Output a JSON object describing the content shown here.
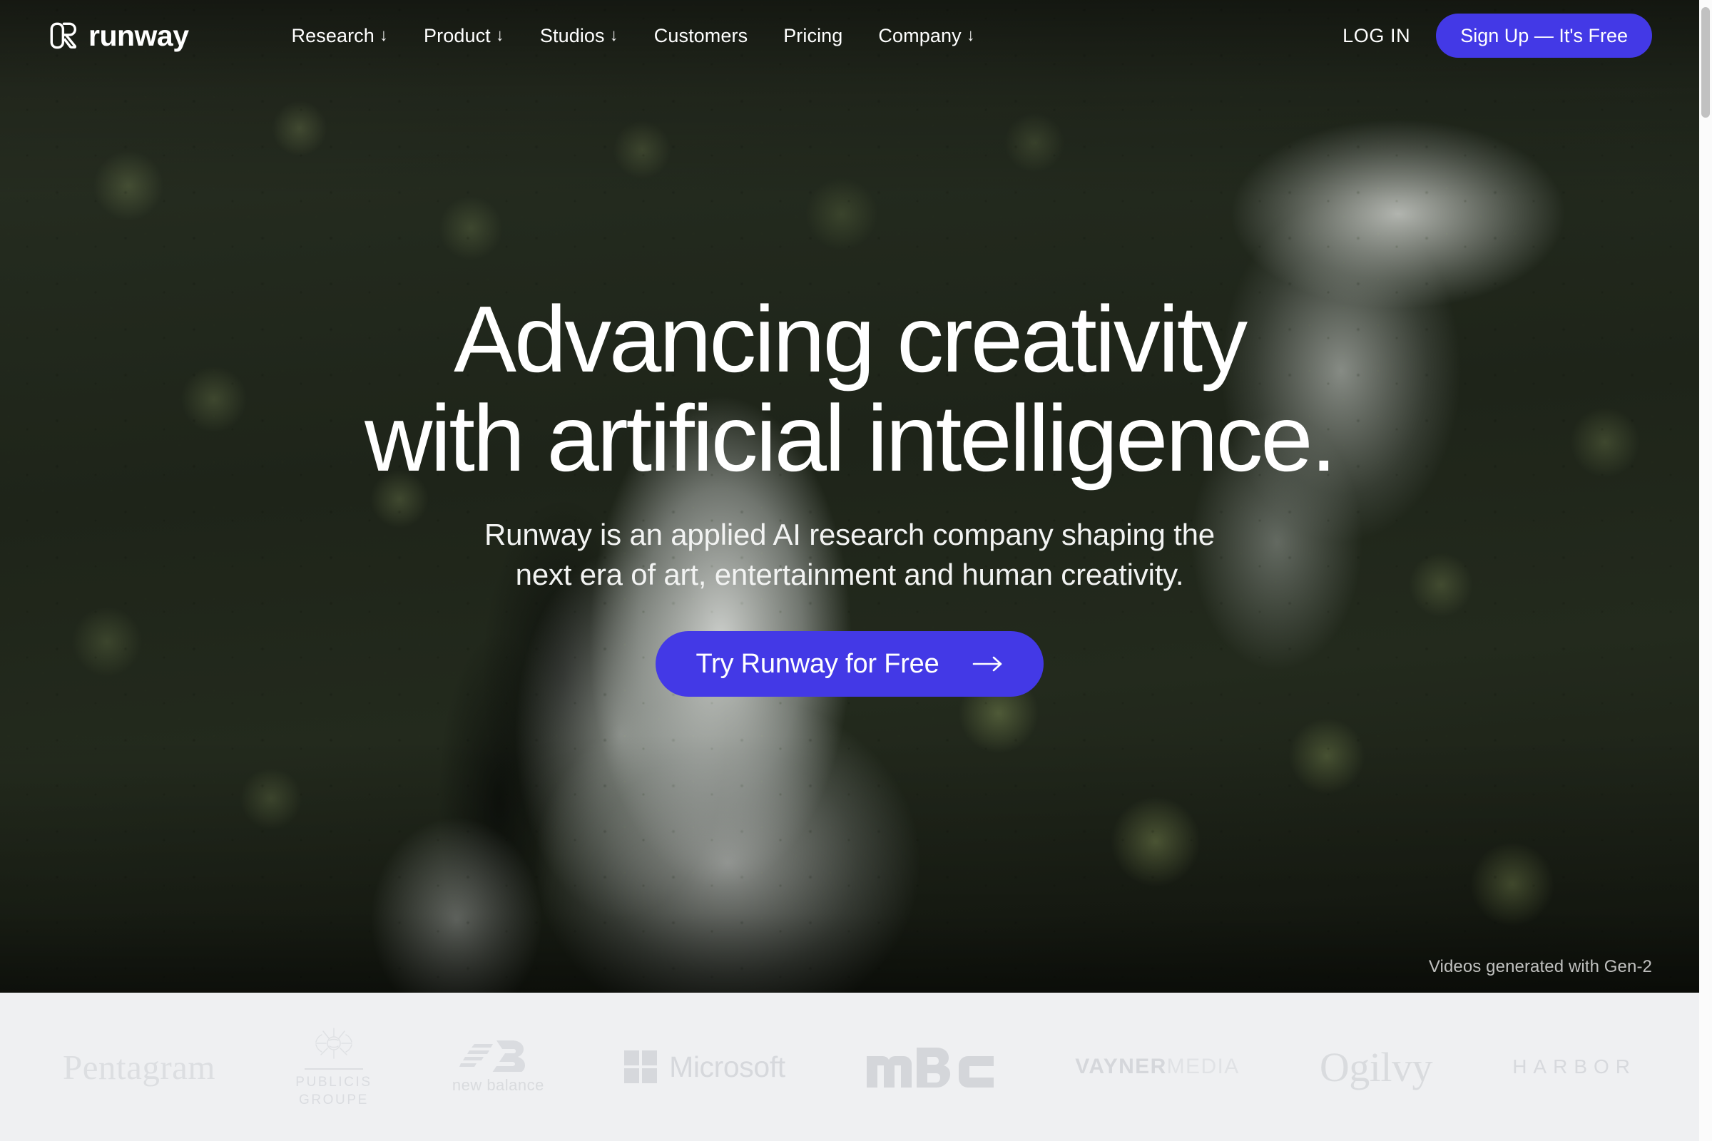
{
  "brand": {
    "name": "runway",
    "mark_icon": "runway-logo-icon"
  },
  "nav": {
    "links": [
      {
        "label": "Research",
        "icon": "arrow-down-icon",
        "arrow": "↓"
      },
      {
        "label": "Product",
        "icon": "arrow-down-icon",
        "arrow": "↓"
      },
      {
        "label": "Studios",
        "icon": "arrow-down-icon",
        "arrow": "↓"
      },
      {
        "label": "Customers",
        "icon": "",
        "arrow": ""
      },
      {
        "label": "Pricing",
        "icon": "",
        "arrow": ""
      },
      {
        "label": "Company",
        "icon": "arrow-down-icon",
        "arrow": "↓"
      }
    ],
    "login_label": "LOG IN",
    "signup_label": "Sign Up — It's Free"
  },
  "hero": {
    "headline_line1": "Advancing creativity",
    "headline_line2": "with artificial intelligence.",
    "subhead_line1": "Runway is an applied AI research company shaping the",
    "subhead_line2": "next era of art, entertainment and human creativity.",
    "cta_label": "Try Runway for Free",
    "cta_icon": "arrow-right-icon",
    "credit": "Videos generated with Gen-2"
  },
  "logos": [
    {
      "name": "Pentagram",
      "text": "Pentagram"
    },
    {
      "name": "Publicis Groupe",
      "line1": "PUBLICIS",
      "line2": "GROUPE"
    },
    {
      "name": "New Balance",
      "text": "new balance"
    },
    {
      "name": "Microsoft",
      "text": "Microsoft"
    },
    {
      "name": "MBC",
      "text": "MBC"
    },
    {
      "name": "VaynerMedia",
      "bold": "VAYNER",
      "light": "MEDIA"
    },
    {
      "name": "Ogilvy",
      "text": "Ogilvy"
    },
    {
      "name": "Harbor",
      "text": "HARBOR"
    }
  ],
  "colors": {
    "accent": "#4339e6",
    "logo_strip_bg": "#eff0f2",
    "text_on_hero": "#ffffff",
    "logo_gray": "#d9dbde"
  }
}
